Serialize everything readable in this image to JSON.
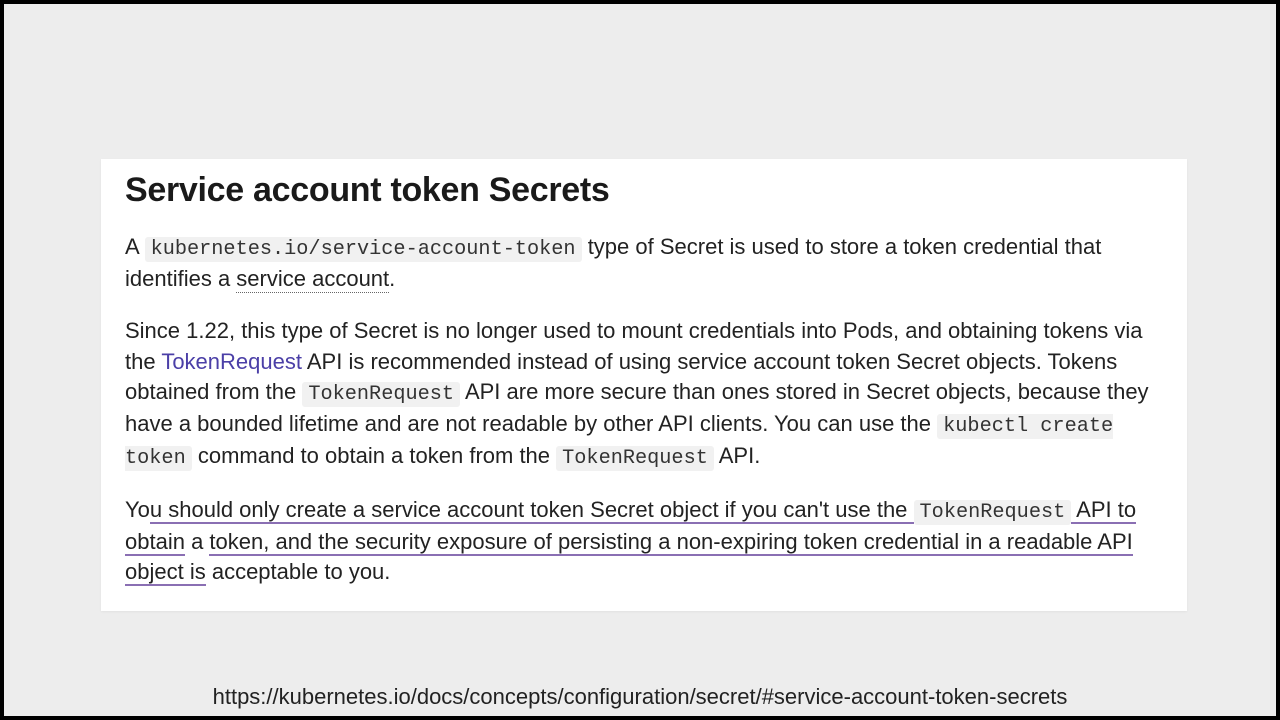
{
  "doc": {
    "title": "Service account token Secrets",
    "p1": {
      "t1": "A ",
      "code1": "kubernetes.io/service-account-token",
      "t2": " type of Secret is used to store a token credential that identifies a ",
      "dotted": "service account",
      "t3": "."
    },
    "p2": {
      "t1": "Since 1.22, this type of Secret is no longer used to mount credentials into Pods, and obtaining tokens via the ",
      "link": "TokenRequest",
      "t2": " API is recommended instead of using service account token Secret objects. Tokens obtained from the ",
      "code1": "TokenRequest",
      "t3": " API are more secure than ones stored in Secret objects, because they have a bounded lifetime and are not readable by other API clients. You can use the ",
      "code2": "kubectl create token",
      "t4": " command to obtain a token from the ",
      "code3": "TokenRequest",
      "t5": " API."
    },
    "p3": {
      "t1": "Yo",
      "u1": "u should only create a service account token Secret object if you can't use the ",
      "code1": "TokenRequest",
      "u2": " API to obtain",
      "t2": " a ",
      "u3": "token, and the security exposure of persisting a non-expiring token credential in a readable API object is",
      "t3": " acceptable to you."
    },
    "footer_url": "https://kubernetes.io/docs/concepts/configuration/secret/#service-account-token-secrets"
  }
}
